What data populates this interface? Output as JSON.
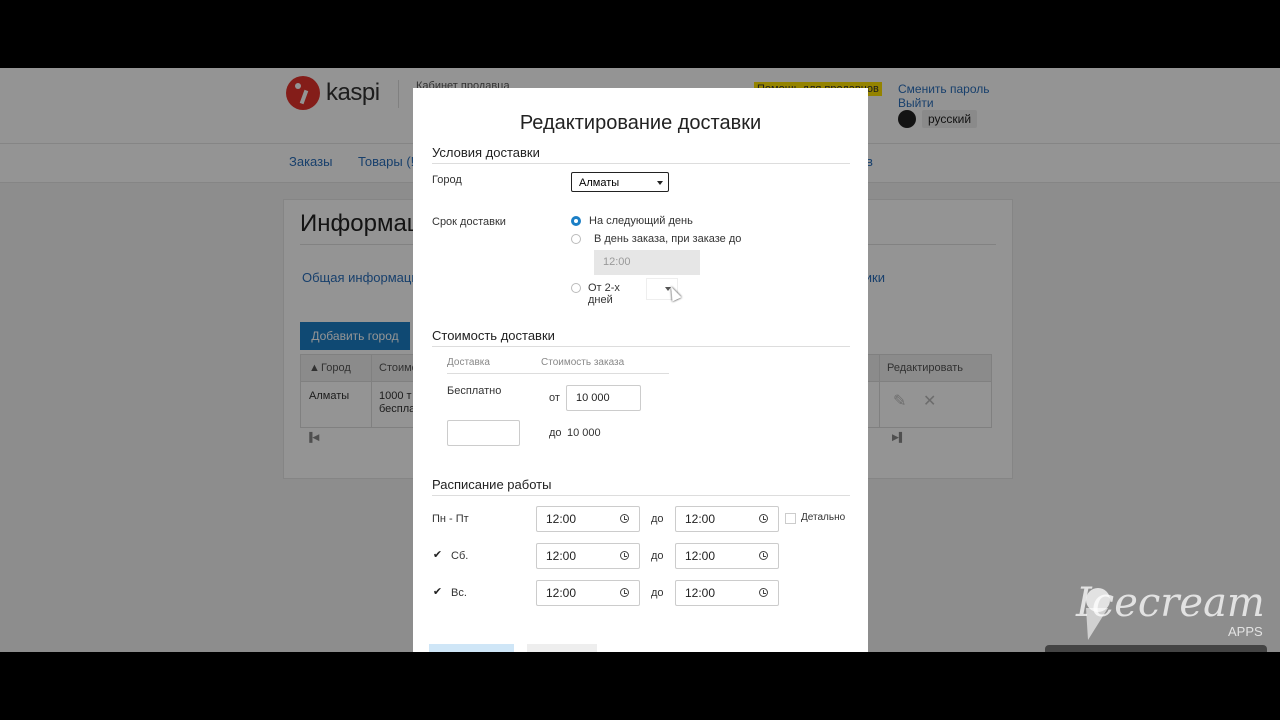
{
  "header": {
    "logo_text": "kaspi",
    "cabinet_title": "Кабинет продавца",
    "help_link": "Помощь для продавцов",
    "change_password": "Сменить пароль",
    "logout": "Выйти",
    "language": "русский"
  },
  "nav": {
    "items": [
      "Заказы",
      "Товары (!",
      "в"
    ]
  },
  "background_page": {
    "title": "Информац",
    "tabs": [
      "Общая информация",
      "дники"
    ],
    "add_city_button": "Добавить город",
    "table": {
      "headers": [
        "Город",
        "Стоимос",
        "Редактировать"
      ],
      "rows": [
        {
          "city": "Алматы",
          "cost_line1": "1000 т",
          "cost_line2": "беспла"
        }
      ]
    }
  },
  "modal": {
    "title": "Редактирование доставки",
    "conditions_section": "Условия доставки",
    "city_label": "Город",
    "city_value": "Алматы",
    "delivery_term_label": "Срок доставки",
    "options": {
      "next_day": "На следующий день",
      "same_day": "В день заказа, при заказе до",
      "same_day_time": "12:00",
      "from_2_days_line1": "От 2-х",
      "from_2_days_line2": "дней"
    },
    "cost_section": "Стоимость доставки",
    "cost_table": {
      "col_delivery": "Доставка",
      "col_order_cost": "Стоимость заказа",
      "free_label": "Бесплатно",
      "from_label": "от",
      "from_value": "10 000",
      "to_label": "до",
      "to_value": "10 000"
    },
    "schedule_section": "Расписание работы",
    "schedule": [
      {
        "day": "Пн - Пт",
        "from": "12:00",
        "to_label": "до",
        "to": "12:00",
        "checked": false
      },
      {
        "day": "Сб.",
        "from": "12:00",
        "to_label": "до",
        "to": "12:00",
        "checked": true
      },
      {
        "day": "Вс.",
        "from": "12:00",
        "to_label": "до",
        "to": "12:00",
        "checked": true
      }
    ],
    "detail_label": "Детально",
    "check_mark": "✔"
  },
  "watermark": {
    "brand": "Icecream",
    "sub": "APPS"
  }
}
